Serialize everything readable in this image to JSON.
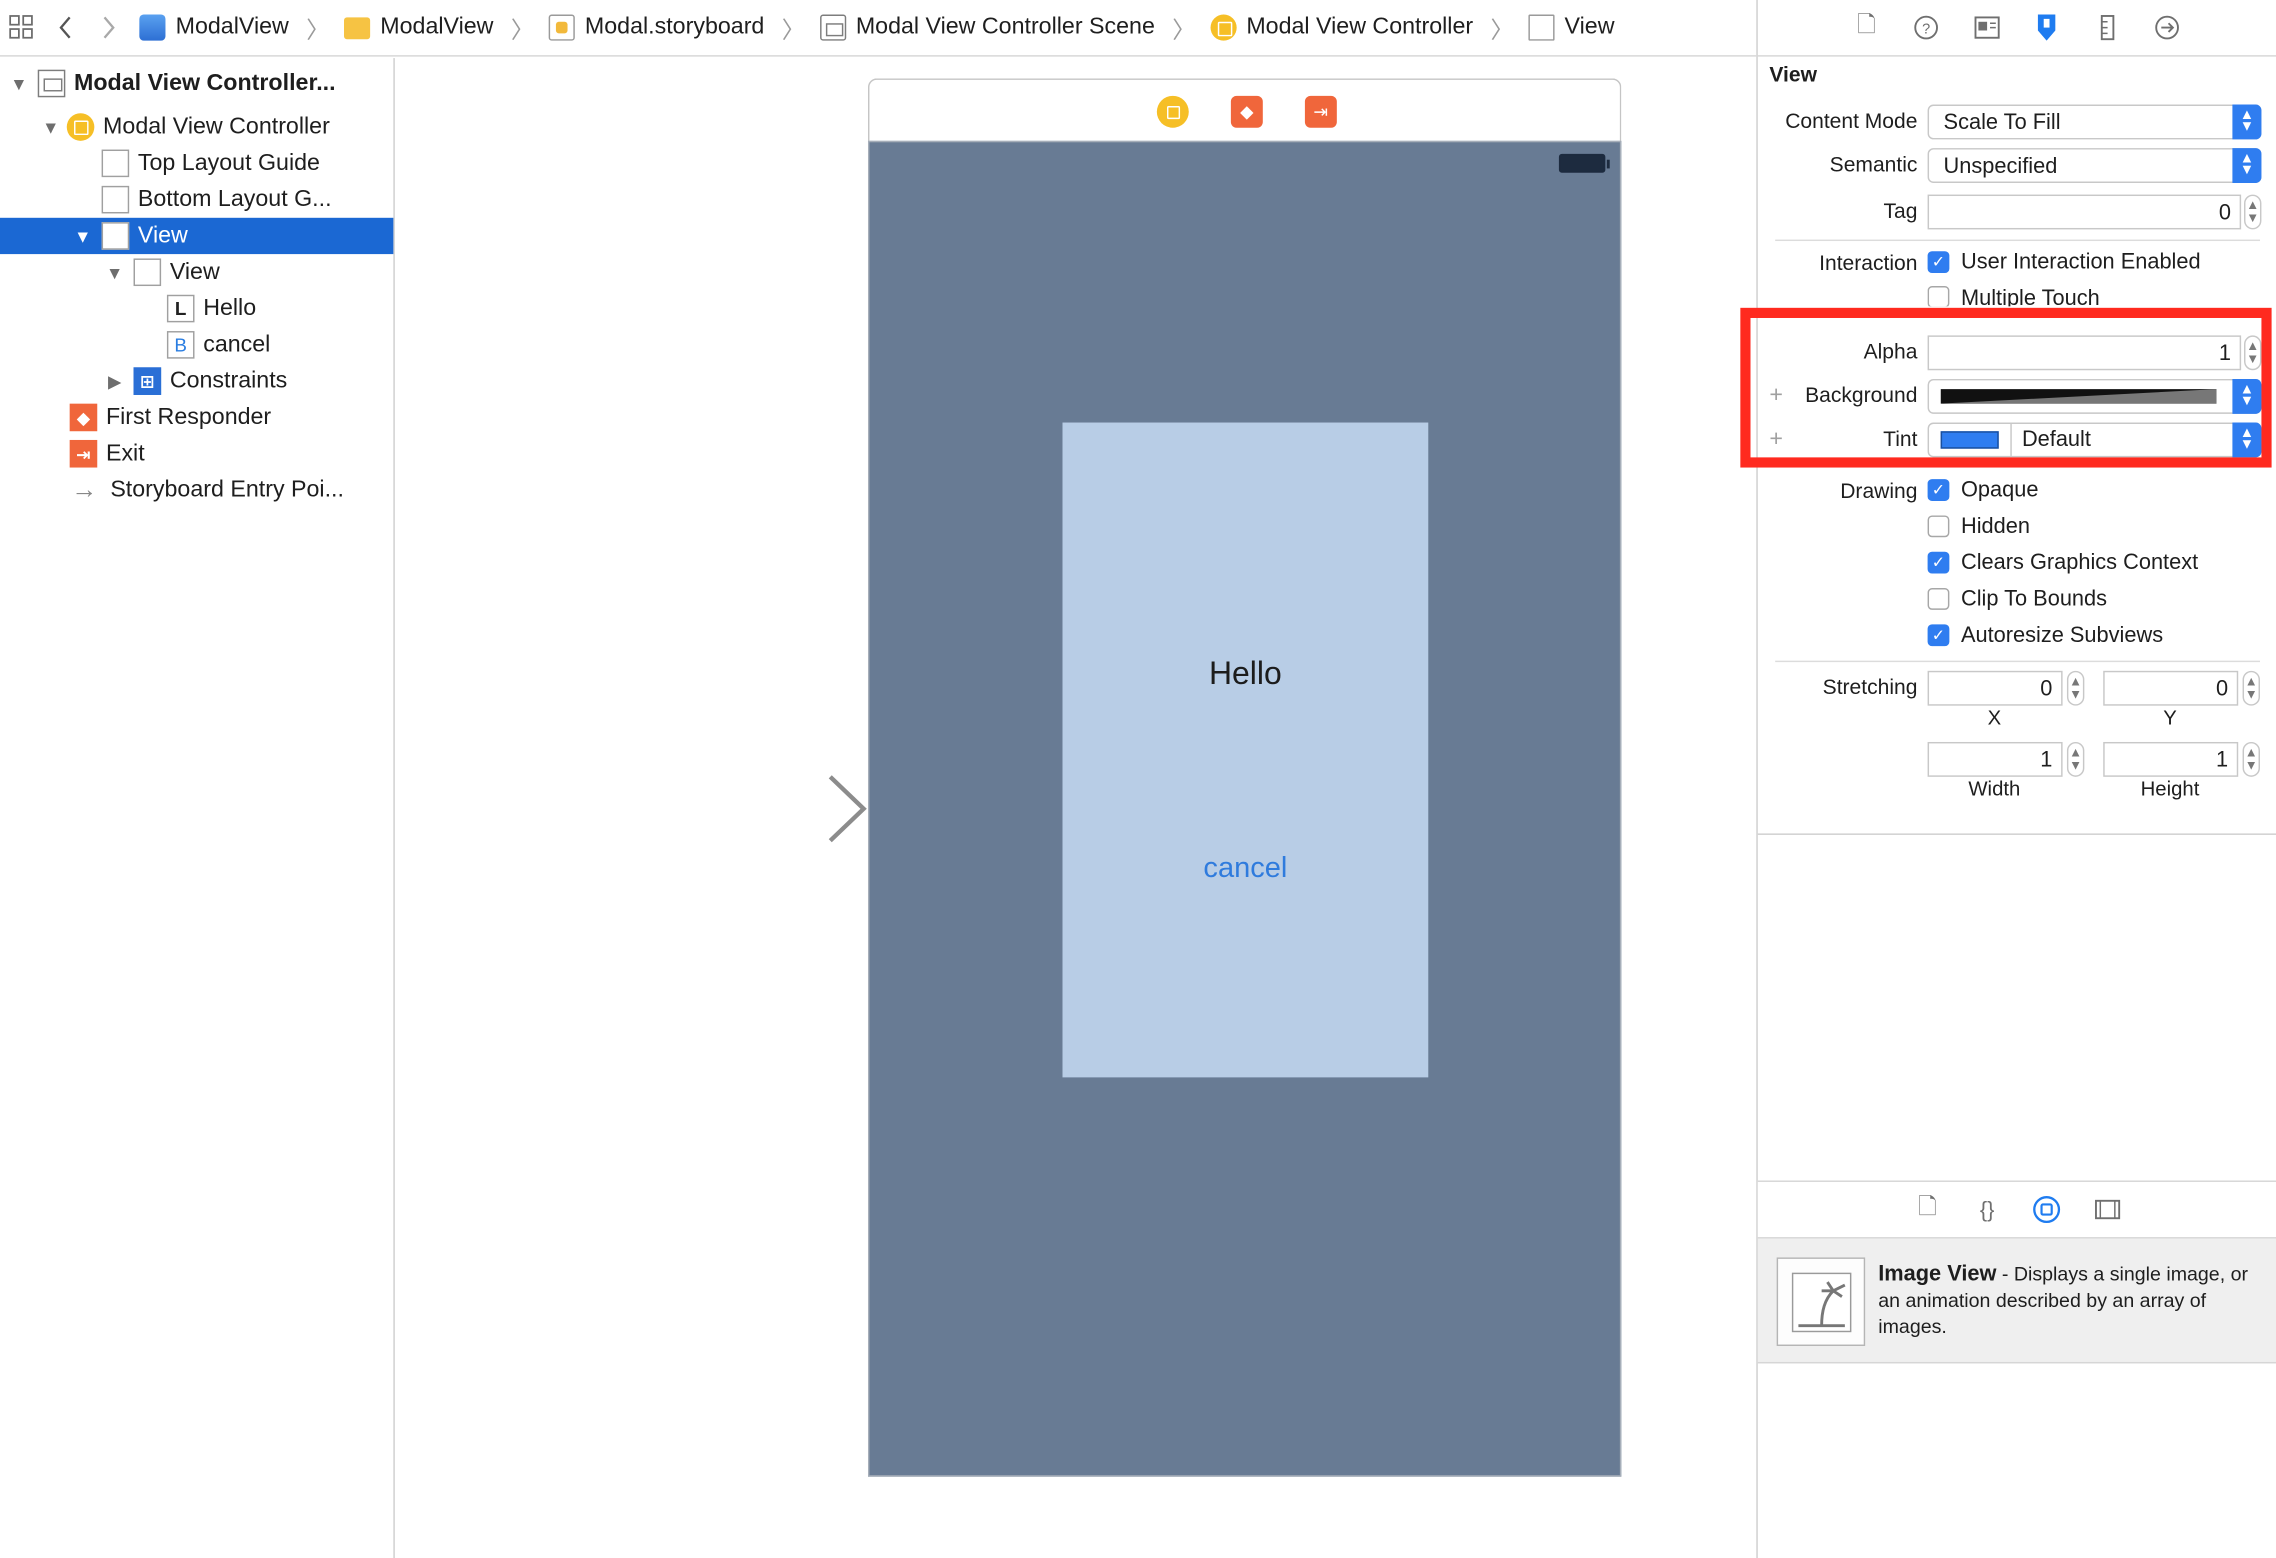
{
  "breadcrumb": [
    {
      "label": "ModalView",
      "icon": "project-icon"
    },
    {
      "label": "ModalView",
      "icon": "folder-icon"
    },
    {
      "label": "Modal.storyboard",
      "icon": "storyboard-icon"
    },
    {
      "label": "Modal View Controller Scene",
      "icon": "scene-icon"
    },
    {
      "label": "Modal View Controller",
      "icon": "view-controller-icon"
    },
    {
      "label": "View",
      "icon": "view-icon"
    }
  ],
  "outline": {
    "scene": "Modal View Controller...",
    "controller": "Modal View Controller",
    "top_guide": "Top Layout Guide",
    "bottom_guide": "Bottom Layout G...",
    "view": "View",
    "subview": "View",
    "label_item": "Hello",
    "label_badge": "L",
    "button_item": "cancel",
    "button_badge": "B",
    "constraints": "Constraints",
    "first_responder": "First Responder",
    "exit": "Exit",
    "entry_point": "Storyboard Entry Poi..."
  },
  "canvas": {
    "hello_label": "Hello",
    "cancel_button": "cancel",
    "colors": {
      "phone_background": "#687b94",
      "card_background": "#b8cde6",
      "button_tint": "#2f7bdd"
    }
  },
  "inspector": {
    "section_title": "View",
    "content_mode_label": "Content Mode",
    "content_mode_value": "Scale To Fill",
    "semantic_label": "Semantic",
    "semantic_value": "Unspecified",
    "tag_label": "Tag",
    "tag_value": "0",
    "interaction_label": "Interaction",
    "user_interaction": "User Interaction Enabled",
    "multiple_touch": "Multiple Touch",
    "alpha_label": "Alpha",
    "alpha_value": "1",
    "background_label": "Background",
    "tint_label": "Tint",
    "tint_value": "Default",
    "drawing_label": "Drawing",
    "opaque": "Opaque",
    "hidden": "Hidden",
    "clears_graphics": "Clears Graphics Context",
    "clip_to_bounds": "Clip To Bounds",
    "autoresize": "Autoresize Subviews",
    "stretching_label": "Stretching",
    "stretch_x": "0",
    "stretch_y": "0",
    "stretch_w": "1",
    "stretch_h": "1",
    "x_label": "X",
    "y_label": "Y",
    "width_label": "Width",
    "height_label": "Height",
    "checks": {
      "user_interaction": true,
      "multiple_touch": false,
      "opaque": true,
      "hidden": false,
      "clears_graphics": true,
      "clip_to_bounds": false,
      "autoresize": true
    },
    "highlight_color": "#ff2a1f"
  },
  "library": {
    "item_title": "Image View",
    "item_description": " - Displays a single image, or an animation described by an array of images."
  }
}
